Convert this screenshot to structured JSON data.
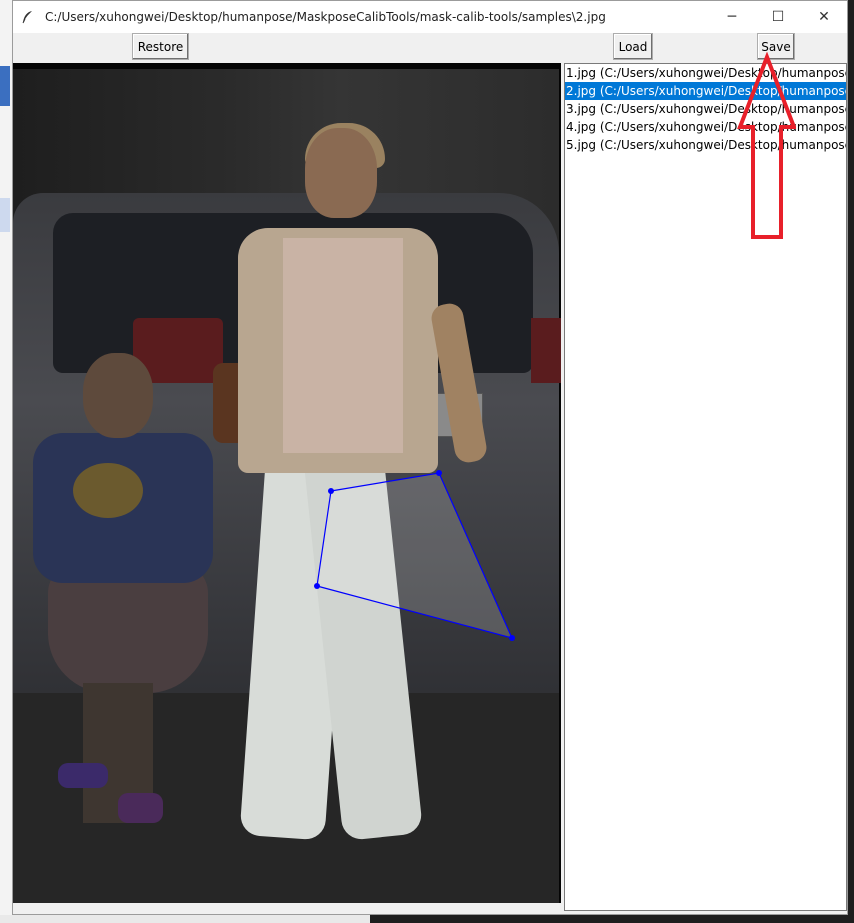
{
  "window": {
    "title": "C:/Users/xuhongwei/Desktop/humanpose/MaskposeCalibTools/mask-calib-tools/samples\\2.jpg",
    "minimize": "─",
    "maximize": "☐",
    "close": "✕"
  },
  "toolbar": {
    "restore_label": "Restore",
    "load_label": "Load",
    "save_label": "Save"
  },
  "file_list": {
    "items": [
      {
        "label": "1.jpg (C:/Users/xuhongwei/Desktop/humanpose",
        "selected": false
      },
      {
        "label": "2.jpg (C:/Users/xuhongwei/Desktop/humanpose",
        "selected": true
      },
      {
        "label": "3.jpg (C:/Users/xuhongwei/Desktop/humanpose",
        "selected": false
      },
      {
        "label": "4.jpg (C:/Users/xuhongwei/Desktop/humanpose",
        "selected": false
      },
      {
        "label": "5.jpg (C:/Users/xuhongwei/Desktop/humanpose",
        "selected": false
      }
    ]
  },
  "annotation": {
    "mask_color": "#0000ff",
    "pointer_color": "#e8202a"
  }
}
